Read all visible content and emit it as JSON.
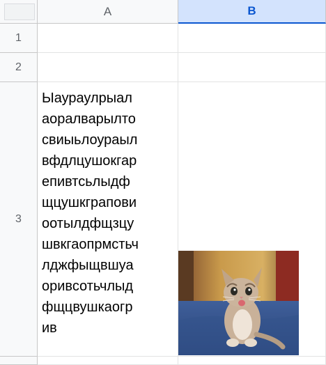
{
  "columns": [
    "A",
    "B"
  ],
  "rows": [
    "1",
    "2",
    "3",
    ""
  ],
  "cells": {
    "A3": "Ыаураулрыал\nаоралварылто\nсвиыьлоураыл\nвфдлцушокгар\nепивтсьлыдф\nщцушкграпови\nоотылдфщзцу\nшвкгаопрмстьч\nлджфыщвшуа\nоривсотьчлыд\nфщцвушкаогр\nив"
  },
  "selection": {
    "column": "B"
  },
  "image": {
    "cell": "B3",
    "icon": "kitten-photo"
  }
}
